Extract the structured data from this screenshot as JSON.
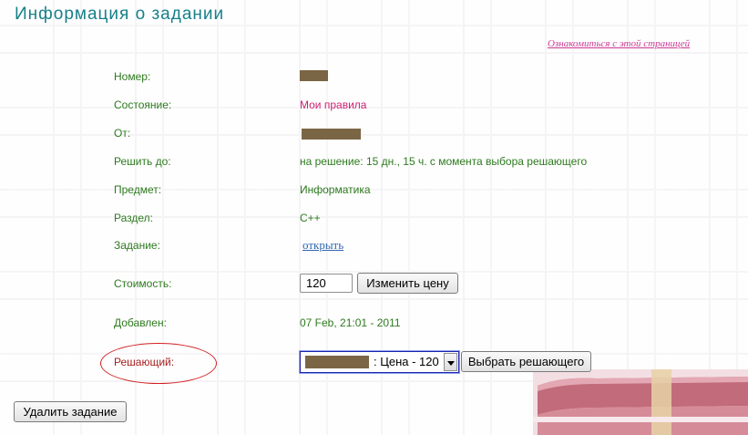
{
  "page": {
    "title": "Информация о задании",
    "about_link": "Ознакомиться с этой страницей"
  },
  "fields": {
    "number_label": "Номер:",
    "status_label": "Состояние:",
    "status_value": "Мои правила",
    "from_label": "От:",
    "deadline_label": "Решить до:",
    "deadline_value": "на решение: 15 дн., 15 ч. с момента выбора решающего",
    "subject_label": "Предмет:",
    "subject_value": "Информатика",
    "section_label": "Раздел:",
    "section_value": "C++",
    "task_label": "Задание:",
    "task_link": "открыть",
    "price_label": "Стоимость:",
    "price_value": "120",
    "added_label": "Добавлен:",
    "added_value": "07 Feb, 21:01 - 2011",
    "solver_label": "Решающий:",
    "solver_selected": ": Цена - 120"
  },
  "buttons": {
    "change_price": "Изменить цену",
    "choose_solver": "Выбрать решающего",
    "delete_task": "Удалить задание"
  },
  "colors": {
    "label_green": "#2d7a1e",
    "status_pink": "#cc1f73",
    "title_teal": "#17808a",
    "highlight_red": "#d22020"
  }
}
